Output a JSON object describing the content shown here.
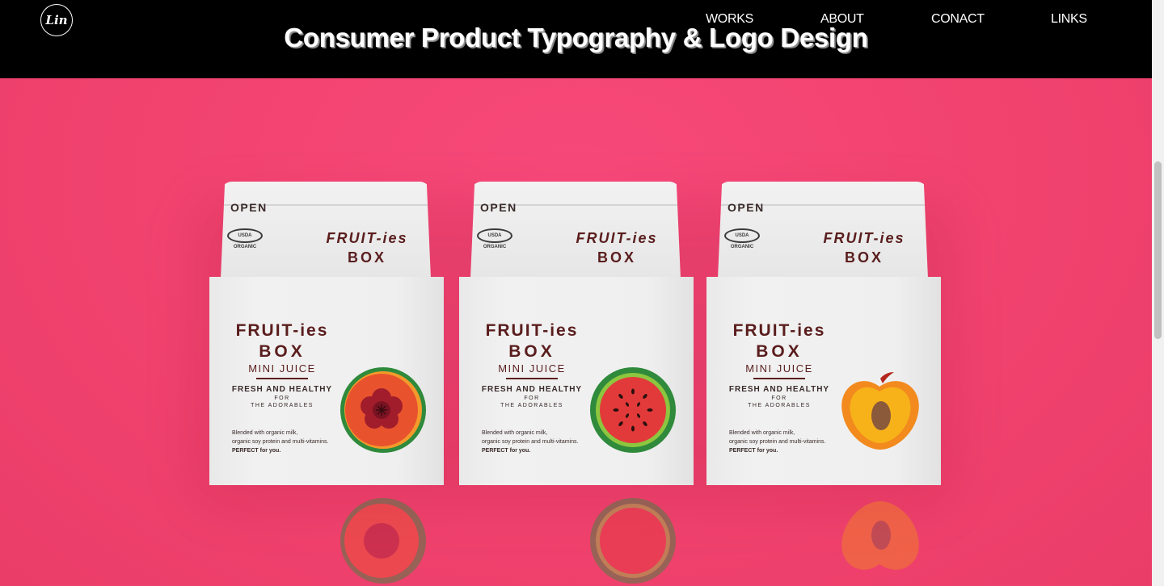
{
  "logo": {
    "text": "Lin"
  },
  "nav": {
    "works": "WORKS",
    "about": "ABOUT",
    "contact": "CONACT",
    "links": "LINKS"
  },
  "page_title": "Consumer Product Typography & Logo Design",
  "carton": {
    "open": "OPEN",
    "usda": "USDA ORGANIC",
    "brand_line1": "FRUIT-ies",
    "brand_line2": "BOX",
    "product": "MINI JUICE",
    "tagline": "FRESH AND HEALTHY",
    "tagline_for": "FOR",
    "tagline_the": "THE ADORABLES",
    "blurb1": "Blended with organic milk,",
    "blurb2": "organic soy protein and multi-vitamins.",
    "blurb3": "PERFECT for you."
  },
  "fruits": [
    "plum-icon",
    "watermelon-icon",
    "apricot-icon"
  ],
  "colors": {
    "background": "#f2436f",
    "header": "#000000",
    "brand_text": "#5a1d1d"
  }
}
